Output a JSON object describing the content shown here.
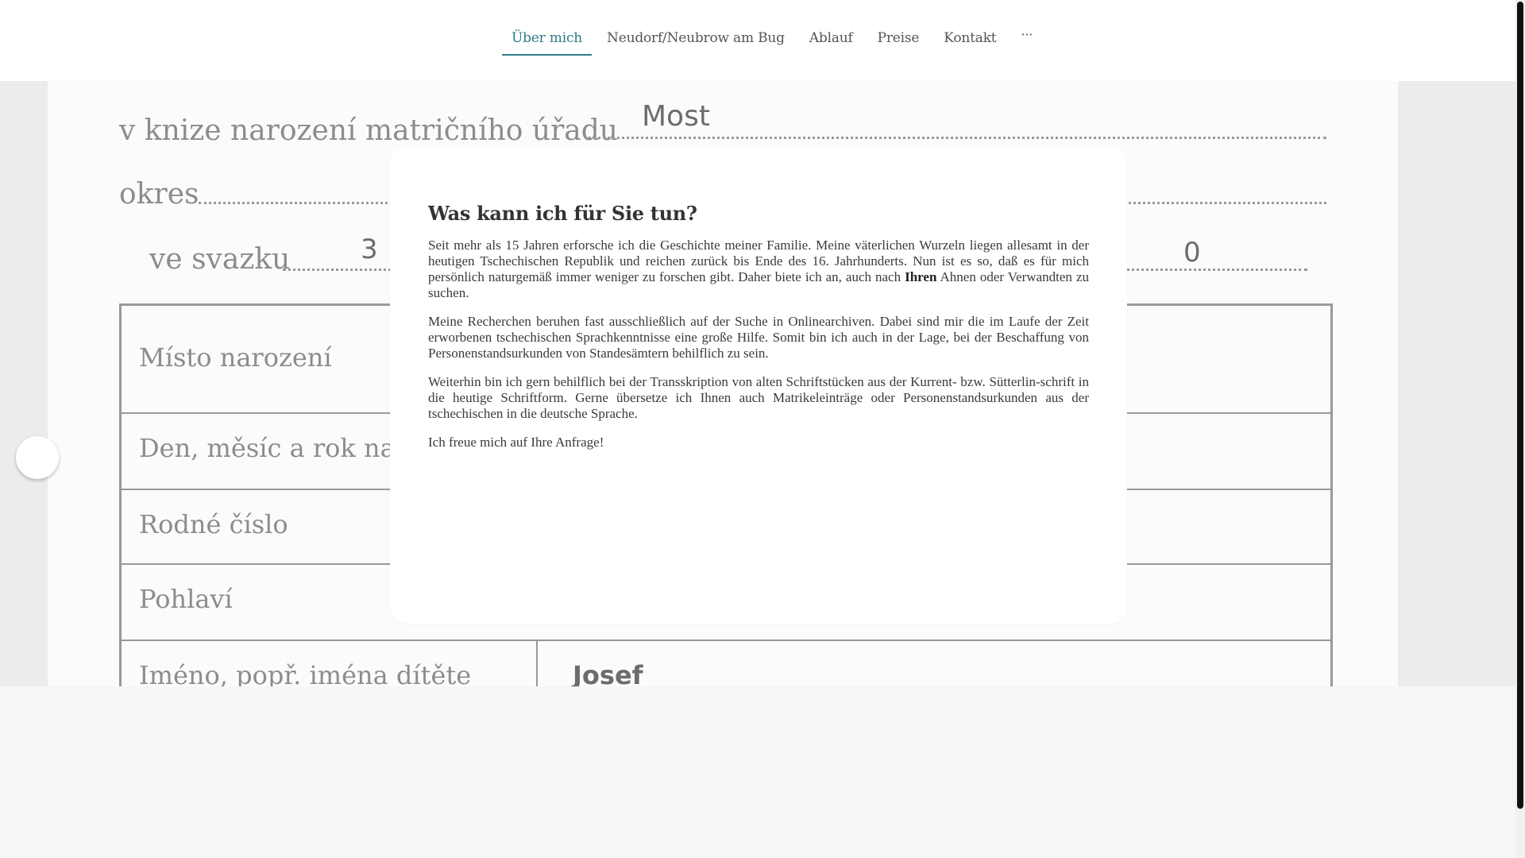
{
  "nav": {
    "items": [
      {
        "label": "Über mich",
        "active": true
      },
      {
        "label": "Neudorf/Neubrow am Bug",
        "active": false
      },
      {
        "label": "Ablauf",
        "active": false
      },
      {
        "label": "Preise",
        "active": false
      },
      {
        "label": "Kontakt",
        "active": false
      }
    ],
    "more": "···"
  },
  "background_document": {
    "line1": "v knize narození matričního úřadu",
    "line1_value": "Most",
    "line2": "okres",
    "line3": "ve svazku",
    "line3_value": "3",
    "line3_value2": "0",
    "fields": [
      "Místo narození",
      "Den, měsíc a rok naro",
      "Rodné číslo",
      "Pohlaví",
      "Iméno, popř. iména dítěte"
    ],
    "field_value": "Josef"
  },
  "card": {
    "title": "Was kann ich für Sie tun?",
    "p1_part1": "Seit mehr als 15 Jahren erforsche ich die Geschichte meiner Familie. Meine väterlichen Wurzeln liegen allesamt in der heutigen Tschechischen Republik und reichen zurück bis Ende des 16. Jahrhunderts. Nun ist es so, daß es für mich persönlich  naturgemäß immer weniger zu forschen gibt. Daher biete ich an, auch nach ",
    "p1_bold": "Ihren",
    "p1_part2": " Ahnen oder Verwandten zu suchen.",
    "p2": "Meine Recherchen beruhen fast ausschließlich auf der Suche in Onlinearchiven. Dabei sind mir die im Laufe der Zeit erworbenen tschechischen Sprachkenntnisse eine große Hilfe. Somit bin ich auch in der Lage, bei der Beschaffung von Personenstandsurkunden von Standesämtern behilflich zu sein.",
    "p3": "Weiterhin bin ich gern behilflich bei der Transskription von alten Schriftstücken aus der Kurrent- bzw. Sütterlin-schrift in die heutige Schriftform. Gerne übersetze ich Ihnen auch Matrikeleinträge oder Personenstandsurkunden aus der tschechischen in die deutsche Sprache.",
    "p4": "Ich freue mich auf Ihre Anfrage!"
  },
  "colors": {
    "accent": "#2f7d86",
    "nav_text": "#555555",
    "page_bg": "#f6f6f6",
    "card_bg": "#ffffff"
  }
}
